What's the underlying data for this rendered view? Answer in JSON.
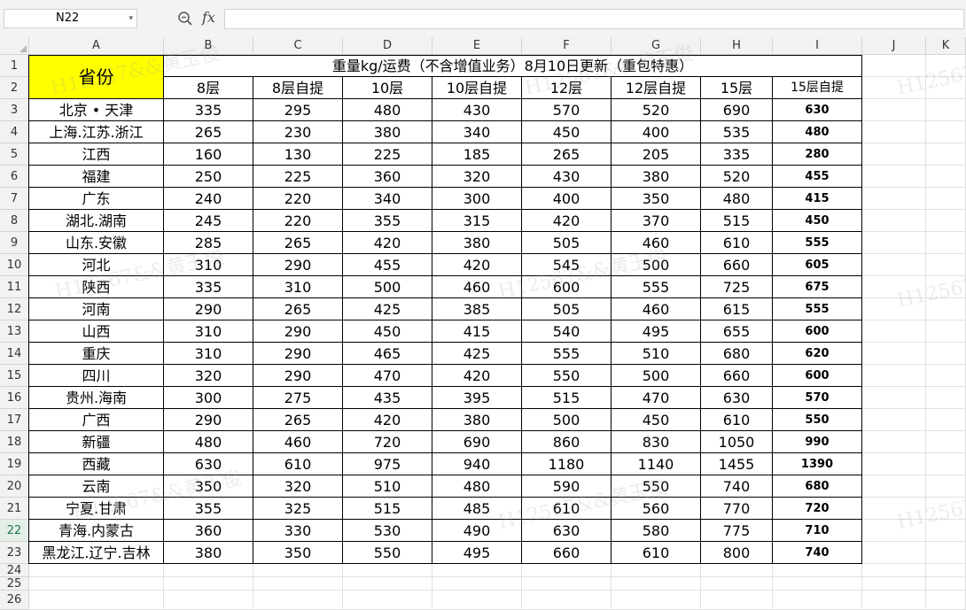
{
  "toolbar": {
    "name_box": "N22",
    "fx_label": "fx",
    "formula_value": ""
  },
  "columns": [
    "A",
    "B",
    "C",
    "D",
    "E",
    "F",
    "G",
    "H",
    "I",
    "J",
    "K"
  ],
  "rows": [
    "1",
    "2",
    "3",
    "4",
    "5",
    "6",
    "7",
    "8",
    "9",
    "10",
    "11",
    "12",
    "13",
    "14",
    "15",
    "16",
    "17",
    "18",
    "19",
    "20",
    "21",
    "22",
    "23",
    "24",
    "25",
    "26"
  ],
  "selected_row": "22",
  "sheet": {
    "province_header": "省份",
    "title": "重量kg/运费（不含增值业务）8月10日更新（重包特惠）",
    "headers": [
      "8层",
      "8层自提",
      "10层",
      "10层自提",
      "12层",
      "12层自提",
      "15层",
      "15层自提"
    ],
    "data": [
      [
        "北京 • 天津",
        "335",
        "295",
        "480",
        "430",
        "570",
        "520",
        "690",
        "630"
      ],
      [
        "上海.江苏.浙江",
        "265",
        "230",
        "380",
        "340",
        "450",
        "400",
        "535",
        "480"
      ],
      [
        "江西",
        "160",
        "130",
        "225",
        "185",
        "265",
        "205",
        "335",
        "280"
      ],
      [
        "福建",
        "250",
        "225",
        "360",
        "320",
        "430",
        "380",
        "520",
        "455"
      ],
      [
        "广东",
        "240",
        "220",
        "340",
        "300",
        "400",
        "350",
        "480",
        "415"
      ],
      [
        "湖北.湖南",
        "245",
        "220",
        "355",
        "315",
        "420",
        "370",
        "515",
        "450"
      ],
      [
        "山东.安徽",
        "285",
        "265",
        "420",
        "380",
        "505",
        "460",
        "610",
        "555"
      ],
      [
        "河北",
        "310",
        "290",
        "455",
        "420",
        "545",
        "500",
        "660",
        "605"
      ],
      [
        "陕西",
        "335",
        "310",
        "500",
        "460",
        "600",
        "555",
        "725",
        "675"
      ],
      [
        "河南",
        "290",
        "265",
        "425",
        "385",
        "505",
        "460",
        "615",
        "555"
      ],
      [
        "山西",
        "310",
        "290",
        "450",
        "415",
        "540",
        "495",
        "655",
        "600"
      ],
      [
        "重庆",
        "310",
        "290",
        "465",
        "425",
        "555",
        "510",
        "680",
        "620"
      ],
      [
        "四川",
        "320",
        "290",
        "470",
        "420",
        "550",
        "500",
        "660",
        "600"
      ],
      [
        "贵州.海南",
        "300",
        "275",
        "435",
        "395",
        "515",
        "470",
        "630",
        "570"
      ],
      [
        "广西",
        "290",
        "265",
        "420",
        "380",
        "500",
        "450",
        "610",
        "550"
      ],
      [
        "新疆",
        "480",
        "460",
        "720",
        "690",
        "860",
        "830",
        "1050",
        "990"
      ],
      [
        "西藏",
        "630",
        "610",
        "975",
        "940",
        "1180",
        "1140",
        "1455",
        "1390"
      ],
      [
        "云南",
        "350",
        "320",
        "510",
        "480",
        "590",
        "550",
        "740",
        "680"
      ],
      [
        "宁夏.甘肃",
        "355",
        "325",
        "515",
        "485",
        "610",
        "560",
        "770",
        "720"
      ],
      [
        "青海.内蒙古",
        "360",
        "330",
        "530",
        "490",
        "630",
        "580",
        "775",
        "710"
      ],
      [
        "黑龙江.辽宁.吉林",
        "380",
        "350",
        "550",
        "495",
        "660",
        "610",
        "800",
        "740"
      ]
    ]
  },
  "watermark": "H12567&&黄玉俊",
  "colors": {
    "province_fill": "#ffff00",
    "selected_row_text": "#1e7b4a"
  },
  "icons": {
    "zoom": "zoom-icon",
    "fx": "fx-icon",
    "dropdown": "chevron-down-icon"
  }
}
